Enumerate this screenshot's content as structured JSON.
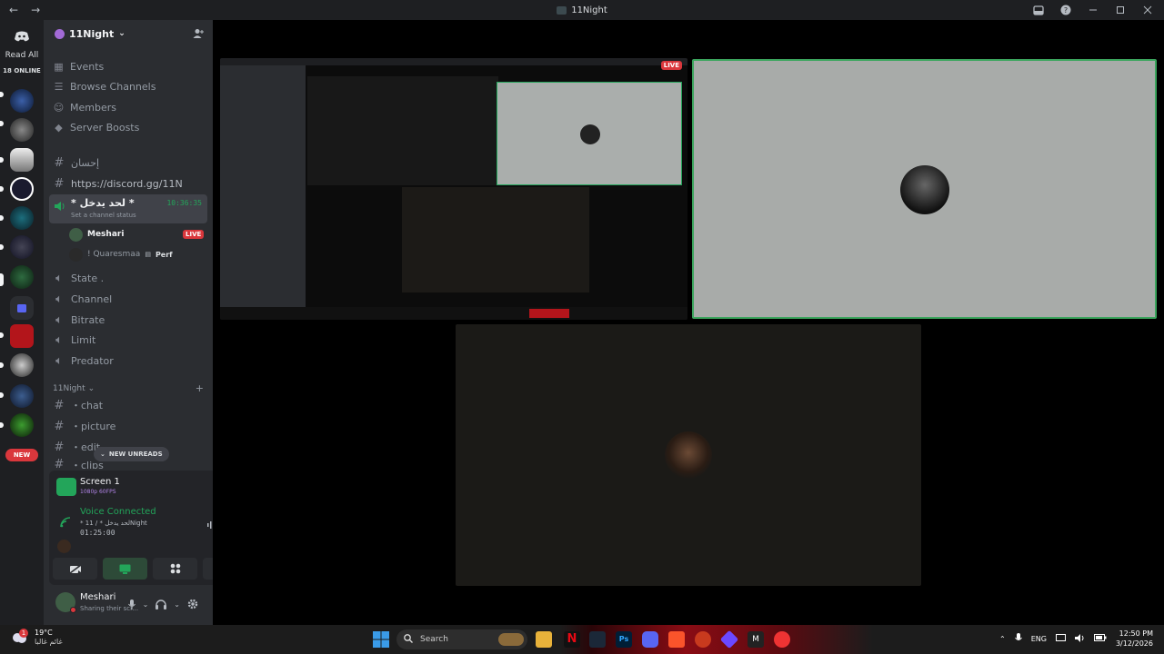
{
  "titlebar": {
    "back": "←",
    "forward": "→",
    "title": "11Night"
  },
  "rail": {
    "read_all": "Read All",
    "online": "18 ONLINE",
    "new_label": "NEW"
  },
  "server": {
    "name": "11Night",
    "nav": [
      {
        "label": "Events",
        "icon": "calendar-icon"
      },
      {
        "label": "Browse Channels",
        "icon": "browse-icon"
      },
      {
        "label": "Members",
        "icon": "members-icon"
      },
      {
        "label": "Server Boosts",
        "icon": "boost-icon"
      }
    ],
    "channels_top": [
      {
        "label": "إحسان",
        "type": "text"
      },
      {
        "label": "https://discord.gg/11N",
        "type": "text"
      }
    ],
    "active_voice": {
      "name": "* لحد يدخل *",
      "status": "Set a channel status",
      "time": "10:36:35"
    },
    "members": [
      {
        "name": "Meshari",
        "badge": "LIVE"
      },
      {
        "name": "! Quaresmaa",
        "tag": "Perf"
      }
    ],
    "voice_channels": [
      "State .",
      "Channel",
      "Bitrate",
      "Limit",
      "Predator"
    ],
    "category": "11Night",
    "text_channels": [
      "・chat",
      "・picture",
      "・edit",
      "・clips"
    ],
    "new_unreads": "NEW UNREADS"
  },
  "voice_panel": {
    "screen_title": "Screen 1",
    "screen_quality": "1080p 60FPS",
    "voice_connected": "Voice Connected",
    "channel_path": "* لحد يدخل * / 11Night",
    "duration": "01:25:00"
  },
  "user": {
    "name": "Meshari",
    "status": "Sharing their scr..."
  },
  "stage": {
    "live_badge": "LIVE"
  },
  "taskbar": {
    "temp": "19°C",
    "weather_text": "غائم غالبا",
    "search": "Search",
    "lang": "ENG",
    "time": "12:50 PM",
    "date": "3/12/2026",
    "notif_count": "1"
  },
  "colors": {
    "accent_green": "#23a55a",
    "live_red": "#da373c",
    "sidebar": "#2b2d31",
    "rail": "#1e1f22"
  }
}
